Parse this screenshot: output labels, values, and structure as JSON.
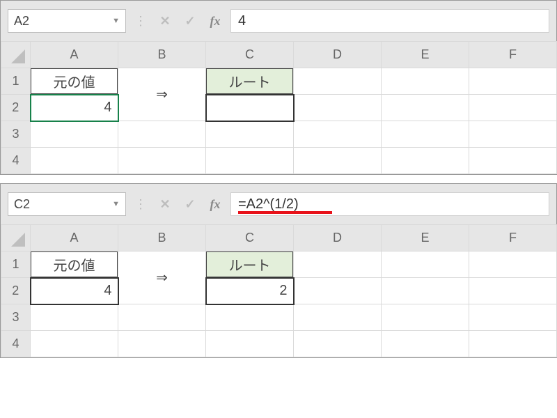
{
  "top": {
    "name_box": "A2",
    "formula": "4",
    "columns": [
      "A",
      "B",
      "C",
      "D",
      "E",
      "F"
    ],
    "rows": [
      "1",
      "2",
      "3",
      "4"
    ],
    "cells": {
      "A1": "元の値",
      "A2": "4",
      "B_arrow": "⇒",
      "C1": "ルート",
      "C2": ""
    },
    "icons": {
      "cancel": "✕",
      "enter": "✓",
      "fx": "fx"
    }
  },
  "bottom": {
    "name_box": "C2",
    "formula": "=A2^(1/2)",
    "columns": [
      "A",
      "B",
      "C",
      "D",
      "E",
      "F"
    ],
    "rows": [
      "1",
      "2",
      "3",
      "4"
    ],
    "cells": {
      "A1": "元の値",
      "A2": "4",
      "B_arrow": "⇒",
      "C1": "ルート",
      "C2": "2"
    },
    "icons": {
      "cancel": "✕",
      "enter": "✓",
      "fx": "fx"
    }
  }
}
